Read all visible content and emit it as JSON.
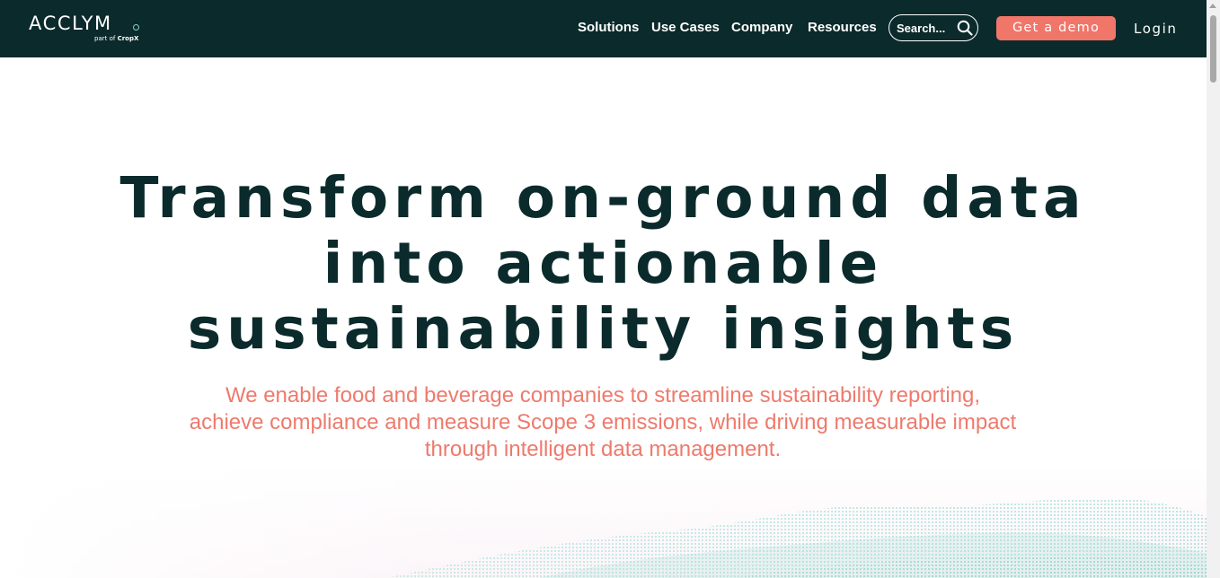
{
  "header": {
    "logo": {
      "word": "ACCLYM",
      "sub_prefix": "part of",
      "sub_brand": "CropX"
    },
    "nav": {
      "solutions": "Solutions",
      "use_cases": "Use Cases",
      "company": "Company",
      "resources": "Resources"
    },
    "search": {
      "placeholder": "Search..."
    },
    "demo_label": "Get a demo",
    "login_label": "Login"
  },
  "hero": {
    "title_line1": "Transform on-ground data",
    "title_line2": "into actionable",
    "title_line3": "sustainability insights",
    "subtitle_line1": "We enable food and beverage companies to streamline sustainability reporting,",
    "subtitle_line2": "achieve compliance and measure Scope 3 emissions, while driving measurable impact",
    "subtitle_line3": "through intelligent data management."
  },
  "colors": {
    "header_bg": "#0b2a2b",
    "accent": "#f0766a",
    "title": "#0b2a2b",
    "subtitle": "#ee7a6c",
    "wave": "#7fd3c6"
  },
  "icons": {
    "search": "search-icon",
    "logo_dot": "ring-dot-icon"
  }
}
